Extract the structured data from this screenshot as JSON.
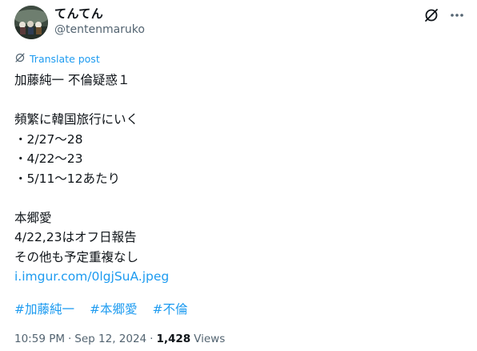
{
  "author": {
    "display_name": "てんてん",
    "handle": "@tentenmaruko"
  },
  "icons": {
    "avatar": "avatar-image",
    "grok": "grok-icon",
    "more": "more-horizontal-icon",
    "translate": "translate-icon"
  },
  "translate_label": "Translate post",
  "body": {
    "title": "加藤純一 不倫疑惑１",
    "para1_heading": "頻繁に韓国旅行にいく",
    "dates": [
      "・2/27〜28",
      "・4/22〜23",
      "・5/11〜12あたり"
    ],
    "para2_heading": "本郷愛",
    "para2_line1": "4/22,23はオフ日報告",
    "para2_line2": "その他も予定重複なし",
    "link": "i.imgur.com/0lgjSuA.jpeg"
  },
  "hashtags": [
    "#加藤純一",
    "#本郷愛",
    "#不倫"
  ],
  "meta": {
    "time": "10:59 PM",
    "separator": "·",
    "date": "Sep 12, 2024",
    "views_count": "1,428",
    "views_label": "Views"
  },
  "colors": {
    "accent": "#1d9bf0",
    "text": "#0f1419",
    "secondary": "#536471"
  }
}
